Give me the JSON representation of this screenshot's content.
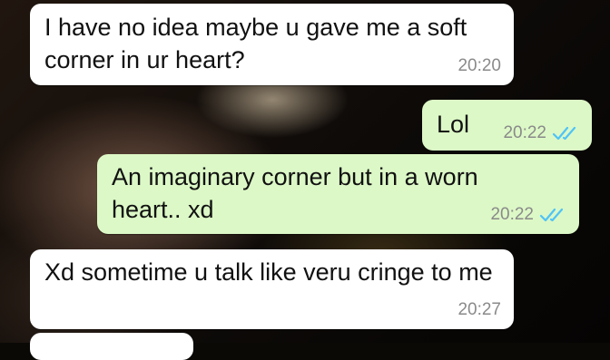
{
  "messages": [
    {
      "text": "I have no idea maybe u gave me a soft corner in ur heart?",
      "time": "20:20",
      "direction": "incoming"
    },
    {
      "text": "Lol",
      "time": "20:22",
      "direction": "outgoing",
      "status": "read"
    },
    {
      "text": "An imaginary corner but in a worn heart..  xd",
      "time": "20:22",
      "direction": "outgoing",
      "status": "read"
    },
    {
      "text": "Xd sometime u talk like veru cringe to me",
      "time": "20:27",
      "direction": "incoming"
    }
  ],
  "colors": {
    "incoming_bubble": "#ffffff",
    "outgoing_bubble": "#dcf8c6",
    "read_ticks": "#4fc3f7",
    "timestamp": "#8a8a8a"
  },
  "icons": {
    "read_receipt": "double-check-icon"
  }
}
